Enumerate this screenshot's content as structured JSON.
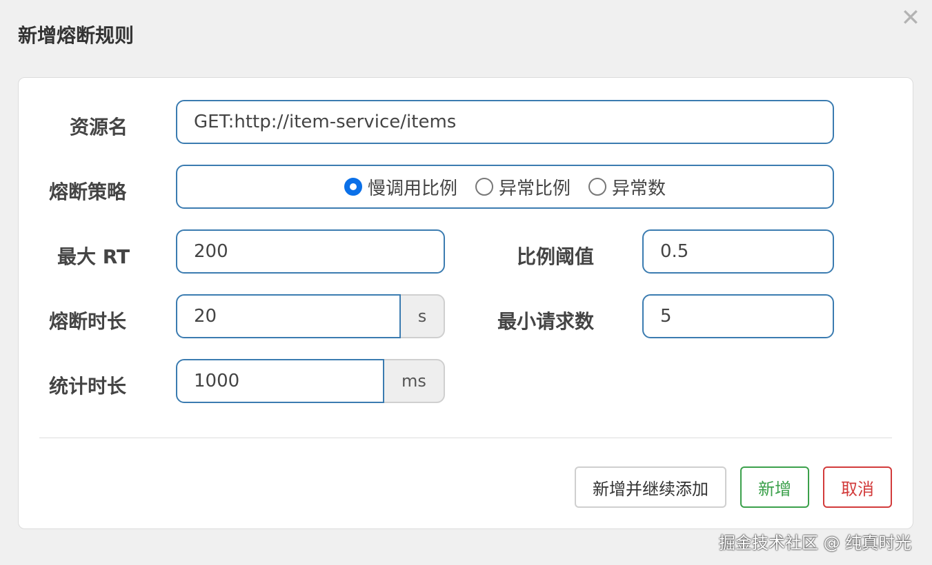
{
  "dialog": {
    "title": "新增熔断规则",
    "close_glyph": "✕"
  },
  "form": {
    "resource": {
      "label": "资源名",
      "value": "GET:http://item-service/items"
    },
    "strategy": {
      "label": "熔断策略",
      "options": [
        "慢调用比例",
        "异常比例",
        "异常数"
      ],
      "selected": "慢调用比例"
    },
    "max_rt": {
      "label": "最大 RT",
      "value": "200"
    },
    "ratio_threshold": {
      "label": "比例阈值",
      "value": "0.5"
    },
    "break_duration": {
      "label": "熔断时长",
      "value": "20",
      "unit": "s"
    },
    "min_requests": {
      "label": "最小请求数",
      "value": "5"
    },
    "stat_duration": {
      "label": "统计时长",
      "value": "1000",
      "unit": "ms"
    }
  },
  "buttons": {
    "add_continue": "新增并继续添加",
    "add": "新增",
    "cancel": "取消"
  },
  "watermark": "掘金技术社区 @ 纯真时光",
  "colors": {
    "primary_border": "#3a7bb0",
    "radio_selected": "#0b70e8",
    "success": "#3aa04a",
    "danger": "#d23a3a"
  }
}
